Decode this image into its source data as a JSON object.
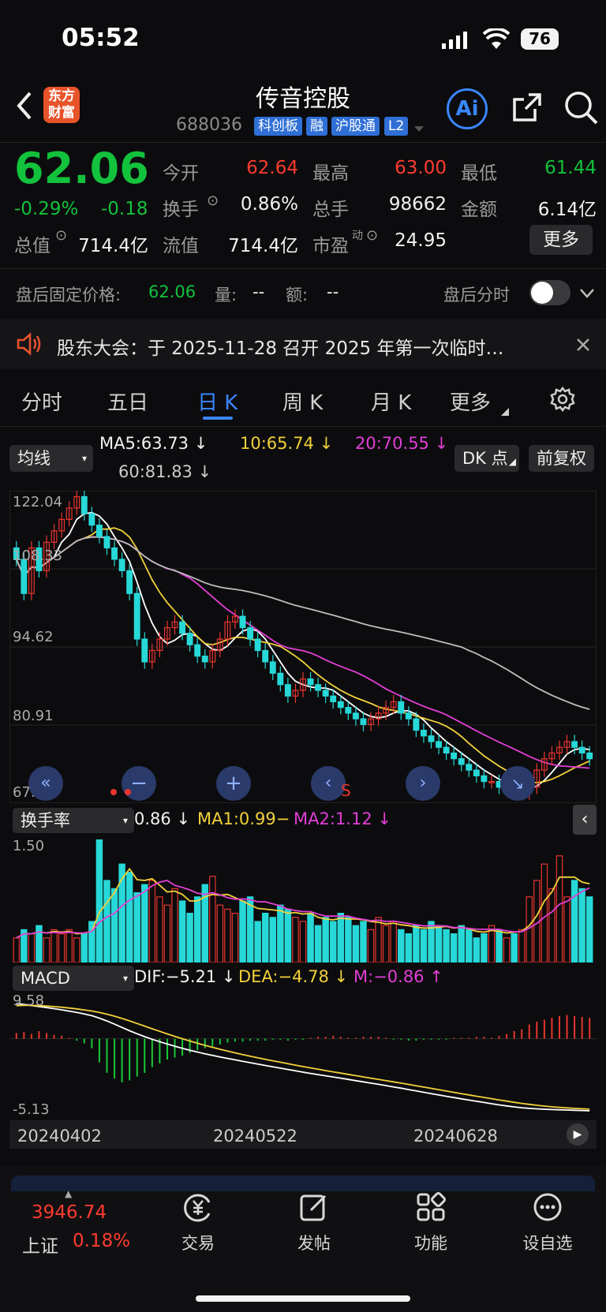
{
  "status_bar": {
    "time": "05:52",
    "battery": "76"
  },
  "header": {
    "title": "传音控股",
    "code": "688036",
    "tags": [
      "科创板",
      "融",
      "沪股通",
      "L2"
    ],
    "logo_text_1": "东方",
    "logo_text_2": "财富",
    "ai_label": "Ai"
  },
  "quote": {
    "price": "62.06",
    "change_pct": "-0.29%",
    "change": "-0.18",
    "open_label": "今开",
    "open": "62.64",
    "high_label": "最高",
    "high": "63.00",
    "low_label": "最低",
    "low": "61.44",
    "turnover_label": "换手",
    "turnover": "0.86%",
    "volume_label": "总手",
    "volume": "98662",
    "amount_label": "金额",
    "amount": "6.14亿",
    "mktcap_label": "总值",
    "mktcap": "714.4亿",
    "float_label": "流值",
    "float": "714.4亿",
    "pe_label": "市盈",
    "pe_sup": "动",
    "pe": "24.95",
    "more": "更多"
  },
  "after_hours": {
    "label": "盘后固定价格:",
    "price": "62.06",
    "vol_label": "量:",
    "vol": "--",
    "amt_label": "额:",
    "amt": "--",
    "intraday_label": "盘后分时"
  },
  "notice": {
    "text": "股东大会：于 2025-11-28 召开 2025 年第一次临时…"
  },
  "tabs": [
    "分时",
    "五日",
    "日 K",
    "周 K",
    "月 K",
    "更多"
  ],
  "kline": {
    "ma_selector": "均线",
    "ma5": "MA5:63.73",
    "ma10": "10:65.74",
    "ma20": "20:70.55",
    "ma60": "60:81.83",
    "dk_btn": "DK 点",
    "adjust_btn": "前复权",
    "y_ticks": [
      "122.04",
      "108.33",
      "94.62",
      "80.91",
      "67.20"
    ],
    "s_marker": "S",
    "colors": {
      "up": "#e8352f",
      "down": "#27d8d8",
      "ma5": "#ffffff",
      "ma10": "#f2d13a",
      "ma20": "#e23fd6",
      "ma60": "#bdbdbd"
    }
  },
  "turnover_panel": {
    "selector": "换手率",
    "value": "0.86",
    "ma1": "MA1:0.99",
    "ma2": "MA2:1.12",
    "y_max": "1.50"
  },
  "macd_panel": {
    "selector": "MACD",
    "dif": "DIF:−5.21",
    "dea": "DEA:−4.78",
    "m": "M:−0.86",
    "y_max": "9.58",
    "y_min": "-5.13"
  },
  "x_axis": [
    "20240402",
    "20240522",
    "20240628"
  ],
  "bottom_nav": {
    "index_value": "3946.74",
    "index_name": "上证",
    "index_change": "0.18%",
    "items": [
      "交易",
      "发帖",
      "功能",
      "设自选"
    ]
  },
  "chart_data": {
    "type": "candlestick",
    "title": "",
    "y_range": [
      67.2,
      122.04
    ],
    "closes": [
      110,
      104,
      112,
      108,
      113,
      115,
      117,
      119,
      121,
      118,
      116,
      114,
      112,
      110,
      108,
      104,
      96,
      92,
      94,
      96,
      98,
      99,
      97,
      95,
      93,
      92,
      94,
      96,
      99,
      100,
      98,
      96,
      94,
      92,
      90,
      88,
      86,
      87,
      89,
      88,
      87,
      86,
      85,
      84,
      83,
      82,
      81,
      82,
      83,
      84,
      85,
      83,
      82,
      80,
      79,
      78,
      77,
      76,
      75,
      74,
      73,
      72,
      71,
      71,
      70,
      70,
      69,
      69,
      70,
      73,
      75,
      76,
      77,
      78,
      77,
      76,
      75
    ],
    "turnover_values": [
      0.3,
      0.4,
      0.35,
      0.45,
      0.3,
      0.4,
      0.35,
      0.4,
      0.3,
      0.35,
      0.5,
      1.5,
      1.0,
      0.9,
      1.2,
      1.1,
      0.85,
      0.95,
      1.0,
      0.8,
      0.7,
      0.9,
      0.75,
      0.6,
      0.8,
      0.95,
      1.05,
      0.7,
      0.65,
      0.6,
      0.75,
      0.8,
      0.5,
      0.6,
      0.55,
      0.7,
      0.65,
      0.55,
      0.5,
      0.6,
      0.45,
      0.55,
      0.5,
      0.6,
      0.55,
      0.45,
      0.5,
      0.4,
      0.55,
      0.45,
      0.5,
      0.4,
      0.35,
      0.45,
      0.4,
      0.5,
      0.45,
      0.4,
      0.35,
      0.45,
      0.4,
      0.3,
      0.35,
      0.45,
      0.4,
      0.3,
      0.35,
      0.4,
      0.8,
      1.0,
      1.2,
      0.9,
      1.3,
      0.8,
      1.0,
      0.9,
      0.8
    ],
    "macd_hist": [
      0.6,
      0.7,
      0.5,
      0.8,
      0.6,
      0.4,
      0.3,
      0.1,
      -0.2,
      -0.5,
      -1.0,
      -2.5,
      -3.6,
      -4.2,
      -4.6,
      -4.4,
      -4.0,
      -3.6,
      -3.0,
      -2.6,
      -2.2,
      -2.0,
      -1.8,
      -1.5,
      -1.2,
      -1.0,
      -0.8,
      -0.6,
      -0.4,
      -0.3,
      -0.3,
      -0.2,
      -0.2,
      -0.2,
      -0.1,
      -0.1,
      -0.2,
      -0.1,
      -0.1,
      0.1,
      0.2,
      0.2,
      0.3,
      0.2,
      0.1,
      0.1,
      0.2,
      0.2,
      0.2,
      0.1,
      -0.1,
      -0.1,
      -0.2,
      -0.2,
      -0.1,
      -0.1,
      -0.1,
      -0.1,
      0.1,
      0.1,
      0.1,
      0.2,
      0.2,
      0.1,
      0.3,
      0.5,
      0.8,
      1.0,
      1.5,
      1.8,
      2.0,
      2.2,
      2.4,
      2.5,
      2.4,
      2.3,
      2.2
    ]
  }
}
